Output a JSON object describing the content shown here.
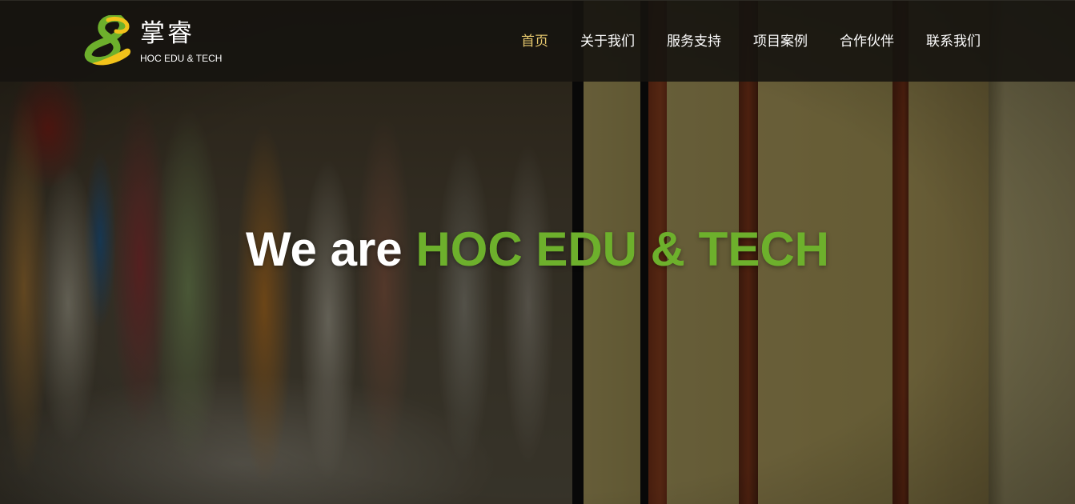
{
  "brand": {
    "name_cn": "掌睿",
    "name_en": "HOC EDU & TECH",
    "logo_icon": "logo-8-icon",
    "colors": {
      "green": "#6db02c",
      "yellow": "#f2c21a"
    }
  },
  "nav": {
    "items": [
      {
        "label": "首页",
        "active": true
      },
      {
        "label": "关于我们",
        "active": false
      },
      {
        "label": "服务支持",
        "active": false
      },
      {
        "label": "项目案例",
        "active": false
      },
      {
        "label": "合作伙伴",
        "active": false
      },
      {
        "label": "联系我们",
        "active": false
      }
    ],
    "active_color": "#e4c66d"
  },
  "hero": {
    "prefix": "We are ",
    "highlight": "HOC EDU & TECH",
    "highlight_color": "#6db02c",
    "background": "blurred bookshelf photo"
  }
}
